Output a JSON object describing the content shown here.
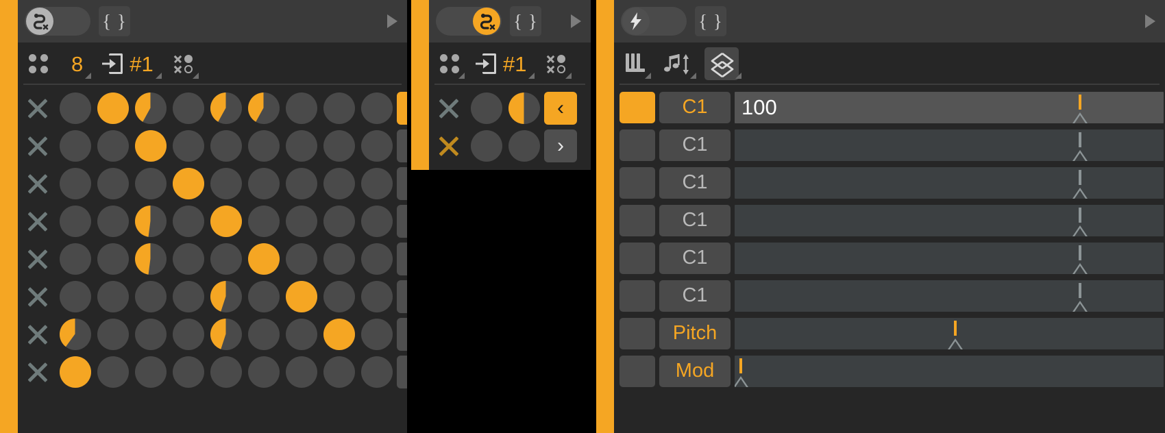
{
  "panels": {
    "left": {
      "name": "step-sequencer-panel",
      "titlebar": {
        "toggle_icon": "snake-loop-icon",
        "toggle_state": "off",
        "brace_label": "{ }",
        "play_icon": "play-triangle-icon"
      },
      "toolbar": {
        "items": [
          {
            "icon": "four-dots-icon",
            "label": "",
            "name": "grid-mode-button"
          },
          {
            "icon": "",
            "label": "8",
            "name": "step-count-field"
          },
          {
            "icon": "step-in-icon",
            "label": "#1",
            "name": "pattern-select-field"
          },
          {
            "icon": "xo-randomize-icon",
            "label": "",
            "name": "randomize-button"
          }
        ]
      },
      "grid": {
        "columns": 9,
        "rows": [
          {
            "x_active": false,
            "cells": [
              0,
              1,
              0.42,
              0,
              0.42,
              0.42,
              0,
              0,
              0
            ],
            "nav": "prev",
            "nav_selected": true
          },
          {
            "x_active": false,
            "cells": [
              0,
              0,
              1,
              0,
              0,
              0,
              0,
              0,
              0
            ],
            "nav": "next",
            "nav_selected": false
          },
          {
            "x_active": false,
            "cells": [
              0,
              0,
              0,
              1,
              0,
              0,
              0,
              0,
              0
            ],
            "nav": "next",
            "nav_selected": false
          },
          {
            "x_active": false,
            "cells": [
              0,
              0,
              0.48,
              0,
              1,
              0,
              0,
              0,
              0
            ],
            "nav": "next",
            "nav_selected": false
          },
          {
            "x_active": false,
            "cells": [
              0,
              0,
              0.48,
              0,
              0,
              1,
              0,
              0,
              0
            ],
            "nav": "next",
            "nav_selected": false
          },
          {
            "x_active": false,
            "cells": [
              0,
              0,
              0,
              0,
              0.45,
              0,
              1,
              0,
              0
            ],
            "nav": "next",
            "nav_selected": false
          },
          {
            "x_active": false,
            "cells": [
              0.4,
              0,
              0,
              0,
              0.45,
              0,
              0,
              1,
              0
            ],
            "nav": "next",
            "nav_selected": false
          },
          {
            "x_active": false,
            "cells": [
              1,
              0,
              0,
              0,
              0,
              0,
              0,
              0,
              0
            ],
            "nav": "next",
            "nav_selected": false
          }
        ],
        "nav_prev_label": "‹",
        "nav_next_label": "›"
      }
    },
    "middle": {
      "name": "mini-sequencer-panel",
      "titlebar": {
        "toggle_icon": "snake-loop-icon",
        "toggle_state": "on",
        "brace_label": "{ }",
        "play_icon": "play-triangle-icon"
      },
      "toolbar": {
        "items": [
          {
            "icon": "four-dots-icon",
            "label": "",
            "name": "grid-mode-button"
          },
          {
            "icon": "step-in-icon",
            "label": "#1",
            "name": "pattern-select-field"
          },
          {
            "icon": "xo-randomize-icon",
            "label": "",
            "name": "randomize-button"
          }
        ]
      },
      "grid": {
        "columns": 2,
        "rows": [
          {
            "x_active": false,
            "cells": [
              0,
              0.5
            ],
            "nav": "prev",
            "nav_selected": true
          },
          {
            "x_active": true,
            "cells": [
              0,
              0
            ],
            "nav": "next",
            "nav_selected": false
          }
        ],
        "nav_prev_label": "‹",
        "nav_next_label": "›"
      }
    },
    "right": {
      "name": "note-lanes-panel",
      "titlebar": {
        "toggle_icon": "lightning-bolt-icon",
        "toggle_state": "off",
        "brace_label": "{ }",
        "play_icon": "play-triangle-icon"
      },
      "toolbar": {
        "items": [
          {
            "icon": "piano-keys-icon",
            "name": "keys-view-button"
          },
          {
            "icon": "note-updown-icon",
            "name": "note-transpose-button"
          },
          {
            "icon": "diamond-updown-icon",
            "name": "velocity-range-button"
          }
        ]
      },
      "lanes": [
        {
          "toggle_on": true,
          "label": "C1",
          "label_accent": true,
          "value": "100",
          "selected": true,
          "marker_pct": 80.5,
          "marker_accent": true
        },
        {
          "toggle_on": false,
          "label": "C1",
          "label_accent": false,
          "value": "",
          "selected": false,
          "marker_pct": 80.5,
          "marker_accent": false
        },
        {
          "toggle_on": false,
          "label": "C1",
          "label_accent": false,
          "value": "",
          "selected": false,
          "marker_pct": 80.5,
          "marker_accent": false
        },
        {
          "toggle_on": false,
          "label": "C1",
          "label_accent": false,
          "value": "",
          "selected": false,
          "marker_pct": 80.5,
          "marker_accent": false
        },
        {
          "toggle_on": false,
          "label": "C1",
          "label_accent": false,
          "value": "",
          "selected": false,
          "marker_pct": 80.5,
          "marker_accent": false
        },
        {
          "toggle_on": false,
          "label": "C1",
          "label_accent": false,
          "value": "",
          "selected": false,
          "marker_pct": 80.5,
          "marker_accent": false
        },
        {
          "toggle_on": false,
          "label": "Pitch",
          "label_accent": true,
          "value": "",
          "selected": false,
          "marker_pct": 51.5,
          "marker_accent": true
        },
        {
          "toggle_on": false,
          "label": "Mod",
          "label_accent": true,
          "value": "",
          "selected": false,
          "marker_pct": 1.5,
          "marker_accent": true
        }
      ]
    }
  },
  "colors": {
    "accent": "#f5a623",
    "panel_bg": "#2b2b2b",
    "grid_bg": "#262626",
    "titlebar_bg": "#3a3a3a",
    "cell_off": "#4a4a4a",
    "track_bg": "#3c4042",
    "background": "#000000"
  }
}
